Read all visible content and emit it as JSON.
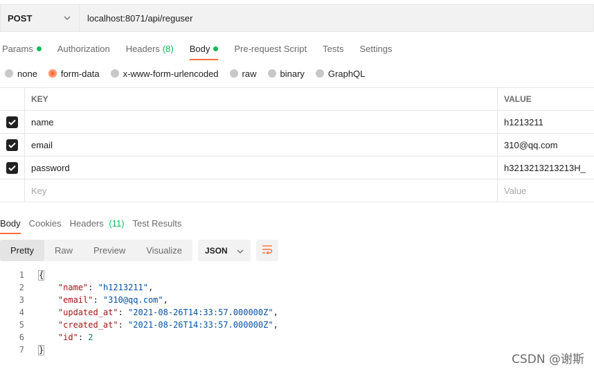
{
  "request": {
    "method": "POST",
    "url": "localhost:8071/api/reguser"
  },
  "request_tabs": [
    {
      "label": "Params",
      "indicator": "dot"
    },
    {
      "label": "Authorization"
    },
    {
      "label": "Headers",
      "count": "(8)"
    },
    {
      "label": "Body",
      "indicator": "dot",
      "active": true
    },
    {
      "label": "Pre-request Script"
    },
    {
      "label": "Tests"
    },
    {
      "label": "Settings"
    }
  ],
  "body_types": [
    {
      "label": "none"
    },
    {
      "label": "form-data",
      "selected": true
    },
    {
      "label": "x-www-form-urlencoded"
    },
    {
      "label": "raw"
    },
    {
      "label": "binary"
    },
    {
      "label": "GraphQL"
    }
  ],
  "params_table": {
    "headers": {
      "key": "KEY",
      "value": "VALUE"
    },
    "rows": [
      {
        "key": "name",
        "value": "h1213211",
        "checked": true
      },
      {
        "key": "email",
        "value": "310@qq.com",
        "checked": true
      },
      {
        "key": "password",
        "value": "h3213213213213H_",
        "checked": true
      }
    ],
    "placeholder": {
      "key": "Key",
      "value": "Value"
    }
  },
  "response_tabs": [
    {
      "label": "Body",
      "active": true
    },
    {
      "label": "Cookies"
    },
    {
      "label": "Headers",
      "count": "(11)"
    },
    {
      "label": "Test Results"
    }
  ],
  "response_views": [
    "Pretty",
    "Raw",
    "Preview",
    "Visualize"
  ],
  "response_format": "JSON",
  "response_body": {
    "line_numbers": [
      "1",
      "2",
      "3",
      "4",
      "5",
      "6",
      "7"
    ],
    "open_brace": "{",
    "close_brace": "}",
    "fields": [
      {
        "key": "\"name\"",
        "value": "\"h1213211\"",
        "type": "string"
      },
      {
        "key": "\"email\"",
        "value": "\"310@qq.com\"",
        "type": "string"
      },
      {
        "key": "\"updated_at\"",
        "value": "\"2021-08-26T14:33:57.000000Z\"",
        "type": "string"
      },
      {
        "key": "\"created_at\"",
        "value": "\"2021-08-26T14:33:57.000000Z\"",
        "type": "string"
      },
      {
        "key": "\"id\"",
        "value": "2",
        "type": "number"
      }
    ]
  },
  "watermark": "CSDN @谢斯",
  "colors": {
    "accent": "#ff6c37",
    "success": "#0cbb52"
  }
}
